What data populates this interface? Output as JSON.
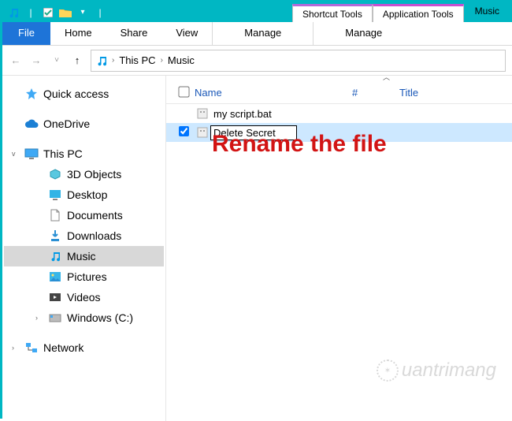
{
  "titlebar": {
    "tool_shortcut": "Shortcut Tools",
    "tool_app": "Application Tools",
    "window_title": "Music"
  },
  "ribbon": {
    "file": "File",
    "tabs": [
      "Home",
      "Share",
      "View"
    ],
    "ctx_tabs": [
      "Manage",
      "Manage"
    ]
  },
  "breadcrumb": {
    "items": [
      "This PC",
      "Music"
    ]
  },
  "columns": {
    "name": "Name",
    "hash": "#",
    "title": "Title"
  },
  "files": [
    {
      "name": "my script.bat",
      "checked": false,
      "renaming": false
    },
    {
      "name": "Delete Secret",
      "checked": true,
      "renaming": true
    }
  ],
  "tree": {
    "quick_access": "Quick access",
    "onedrive": "OneDrive",
    "this_pc": "This PC",
    "children": [
      "3D Objects",
      "Desktop",
      "Documents",
      "Downloads",
      "Music",
      "Pictures",
      "Videos",
      "Windows (C:)"
    ],
    "selected_child": "Music",
    "network": "Network"
  },
  "annotation": "Rename the file",
  "watermark": "uantrimang"
}
